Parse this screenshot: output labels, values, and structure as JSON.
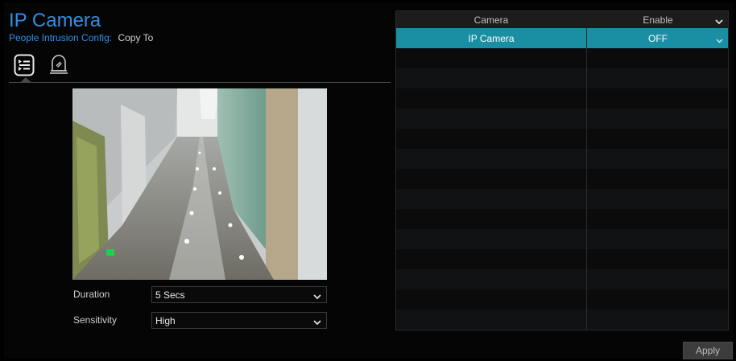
{
  "header": {
    "title": "IP Camera",
    "subtitle_label": "People Intrusion Config:",
    "copy_to": "Copy To"
  },
  "tabs": [
    {
      "icon": "rule-list-icon"
    },
    {
      "icon": "alarm-light-icon"
    }
  ],
  "form": {
    "duration_label": "Duration",
    "duration_value": "5 Secs",
    "sensitivity_label": "Sensitivity",
    "sensitivity_value": "High"
  },
  "table": {
    "columns": [
      "Camera",
      "Enable"
    ],
    "rows": [
      {
        "camera": "IP Camera",
        "enable": "OFF"
      }
    ]
  },
  "footer": {
    "apply_label": "Apply"
  },
  "colors": {
    "accent": "#2f8fe6",
    "selected_row": "#1a8fa3"
  }
}
